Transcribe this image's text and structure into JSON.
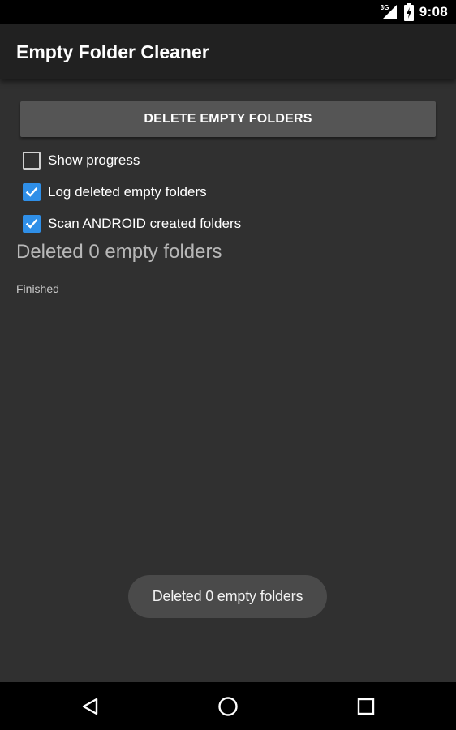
{
  "status_bar": {
    "network_type": "3G",
    "time": "9:08",
    "signal_icon": "cell-signal-icon",
    "battery_icon": "battery-charging-icon"
  },
  "action_bar": {
    "title": "Empty Folder Cleaner"
  },
  "main": {
    "delete_button_label": "DELETE EMPTY FOLDERS",
    "options": [
      {
        "label": "Show progress",
        "checked": false
      },
      {
        "label": "Log deleted empty folders",
        "checked": true
      },
      {
        "label": "Scan ANDROID created folders",
        "checked": true
      }
    ],
    "result_text": "Deleted 0 empty folders",
    "status_text": "Finished"
  },
  "toast": {
    "message": "Deleted 0 empty folders"
  },
  "nav_bar": {
    "back_icon": "back-triangle-icon",
    "home_icon": "home-circle-icon",
    "recents_icon": "recents-square-icon"
  },
  "colors": {
    "background": "#303030",
    "action_bar": "#212121",
    "button": "#555555",
    "checkbox_accent": "#2f8fe8",
    "toast": "#4a4a4a"
  }
}
